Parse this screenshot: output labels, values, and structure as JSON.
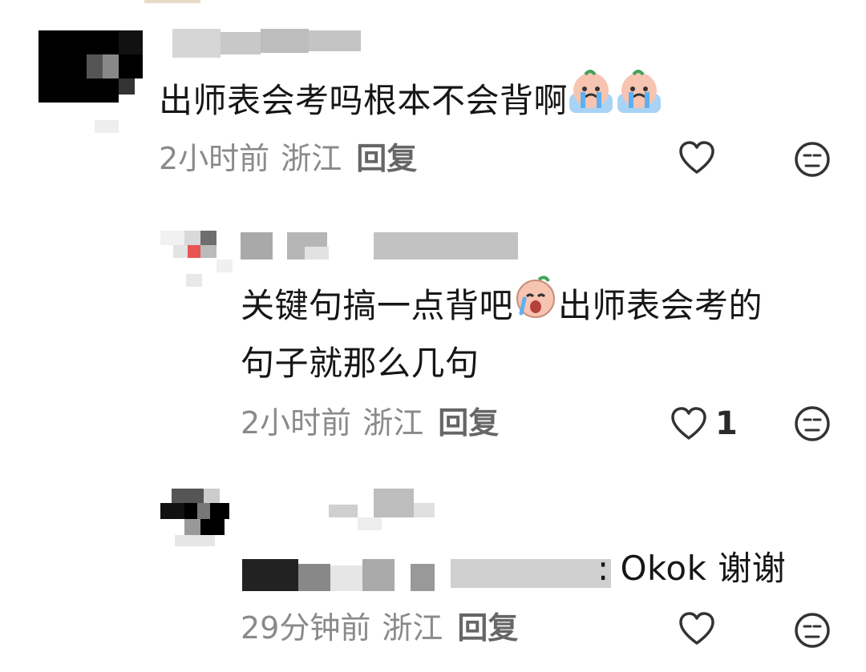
{
  "comments": [
    {
      "text": "出师表会考吗根本不会背啊",
      "time": "2小时前",
      "location": "浙江",
      "reply_label": "回复",
      "like_icon": "heart-outline-icon",
      "dislike_icon": "neutral-face-icon"
    },
    {
      "text_line1": "关键句搞一点背吧",
      "text_line1b": "出师表会考的",
      "text_line2": "句子就那么几句",
      "time": "2小时前",
      "location": "浙江",
      "reply_label": "回复",
      "like_count": "1",
      "like_icon": "heart-outline-icon",
      "dislike_icon": "neutral-face-icon"
    },
    {
      "text_suffix": ": Okok 谢谢",
      "time": "29分钟前",
      "location": "浙江",
      "reply_label": "回复",
      "like_icon": "heart-outline-icon",
      "dislike_icon": "neutral-face-icon"
    }
  ],
  "colors": {
    "text": "#161616",
    "meta": "#8a8a8a",
    "reply": "#666666"
  }
}
